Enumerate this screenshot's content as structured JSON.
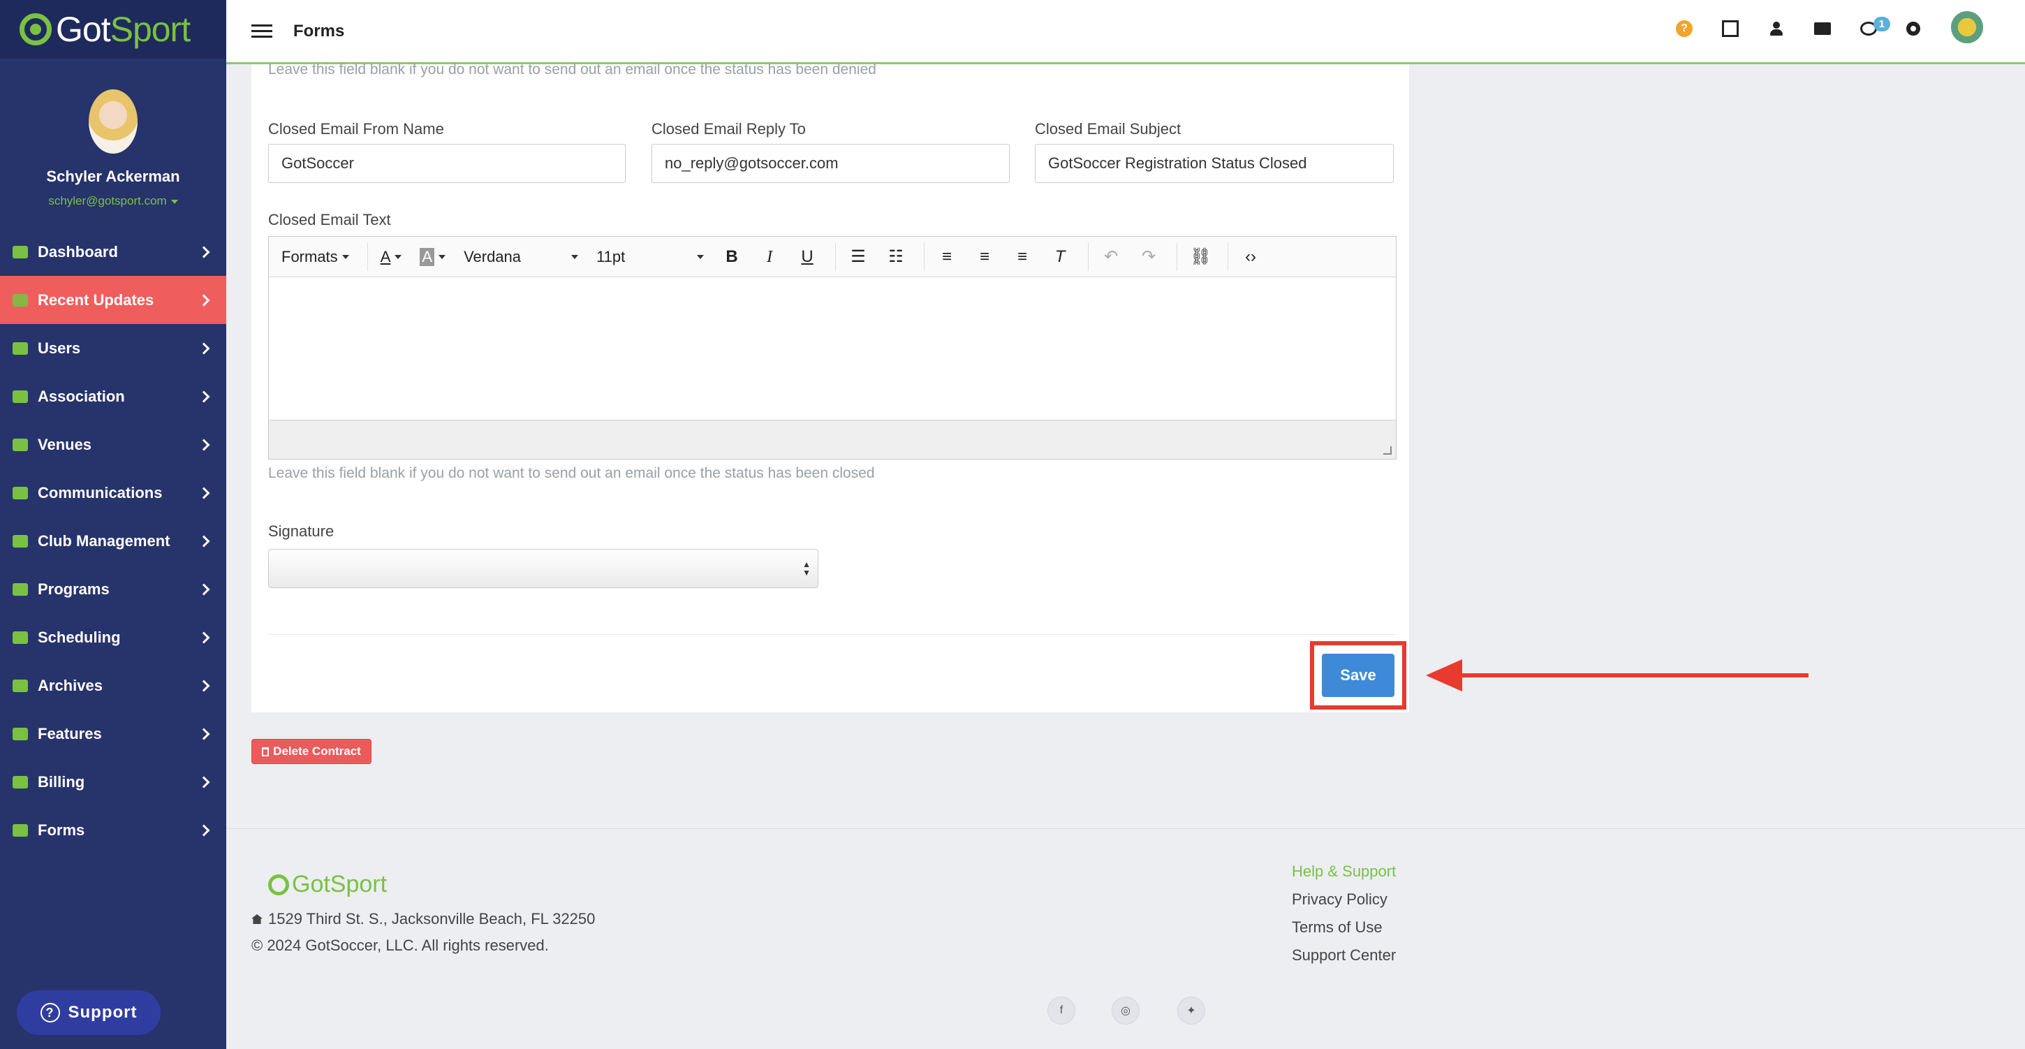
{
  "app": {
    "logo_got": "Got",
    "logo_sport": "Sport"
  },
  "profile": {
    "name": "Schyler Ackerman",
    "email": "schyler@gotsport.com"
  },
  "sidebar": {
    "items": [
      {
        "label": "Dashboard",
        "icon": "dashboard-icon"
      },
      {
        "label": "Recent Updates",
        "icon": "refresh-icon"
      },
      {
        "label": "Users",
        "icon": "users-icon"
      },
      {
        "label": "Association",
        "icon": "sitemap-icon"
      },
      {
        "label": "Venues",
        "icon": "home-icon"
      },
      {
        "label": "Communications",
        "icon": "chat-icon"
      },
      {
        "label": "Club Management",
        "icon": "list-icon"
      },
      {
        "label": "Programs",
        "icon": "document-icon"
      },
      {
        "label": "Scheduling",
        "icon": "calendar-icon"
      },
      {
        "label": "Archives",
        "icon": "archive-icon"
      },
      {
        "label": "Features",
        "icon": "star-icon"
      },
      {
        "label": "Billing",
        "icon": "credit-card-icon"
      },
      {
        "label": "Forms",
        "icon": "file-icon"
      }
    ],
    "active_index": 1,
    "support_label": "Support"
  },
  "header": {
    "title": "Forms",
    "chat_badge": "1"
  },
  "form": {
    "denied_hint": "Leave this field blank if you do not want to send out an email once the status has been denied",
    "closed_from_name_label": "Closed Email From Name",
    "closed_from_name_value": "GotSoccer",
    "closed_reply_to_label": "Closed Email Reply To",
    "closed_reply_to_value": "no_reply@gotsoccer.com",
    "closed_subject_label": "Closed Email Subject",
    "closed_subject_value": "GotSoccer Registration Status Closed",
    "closed_text_label": "Closed Email Text",
    "closed_hint": "Leave this field blank if you do not want to send out an email once the status has been closed",
    "signature_label": "Signature",
    "signature_value": "",
    "save_label": "Save",
    "delete_label": "Delete Contract"
  },
  "editor": {
    "formats": "Formats",
    "font": "Verdana",
    "size": "11pt"
  },
  "footer": {
    "logo": "GotSport",
    "address": "1529 Third St. S., Jacksonville Beach, FL 32250",
    "copyright": "© 2024 GotSoccer, LLC. All rights reserved.",
    "links": [
      "Help & Support",
      "Privacy Policy",
      "Terms of Use",
      "Support Center"
    ]
  },
  "colors": {
    "sidebar_bg": "#27336b",
    "accent_green": "#7ac142",
    "active_nav": "#f05d5d",
    "save_blue": "#3e8ad8",
    "annotation_red": "#e83a2e"
  }
}
